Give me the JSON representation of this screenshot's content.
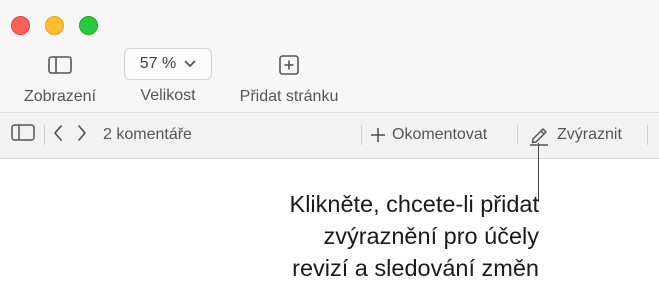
{
  "window": {
    "traffic_lights": {
      "close_color": "#ff5f57",
      "minimize_color": "#febc2e",
      "maximize_color": "#28c840"
    }
  },
  "toolbar": {
    "view_label": "Zobrazení",
    "zoom_value": "57 %",
    "zoom_label": "Velikost",
    "add_page_label": "Přidat stránku"
  },
  "comments_bar": {
    "count_label": "2 komentáře",
    "add_comment_label": "Okomentovat",
    "highlight_label": "Zvýraznit"
  },
  "callout": {
    "lines": [
      "Klikněte, chcete-li přidat",
      "zvýraznění pro účely",
      "revizí a sledování změn"
    ]
  },
  "icons": {
    "view": "sidebar-icon",
    "zoom_dropdown": "chevron-down-icon",
    "add_page": "plus-square-icon",
    "sidebar_toggle": "sidebar-icon",
    "prev": "chevron-left-icon",
    "next": "chevron-right-icon",
    "add_comment": "plus-icon",
    "highlight": "pen-icon"
  }
}
